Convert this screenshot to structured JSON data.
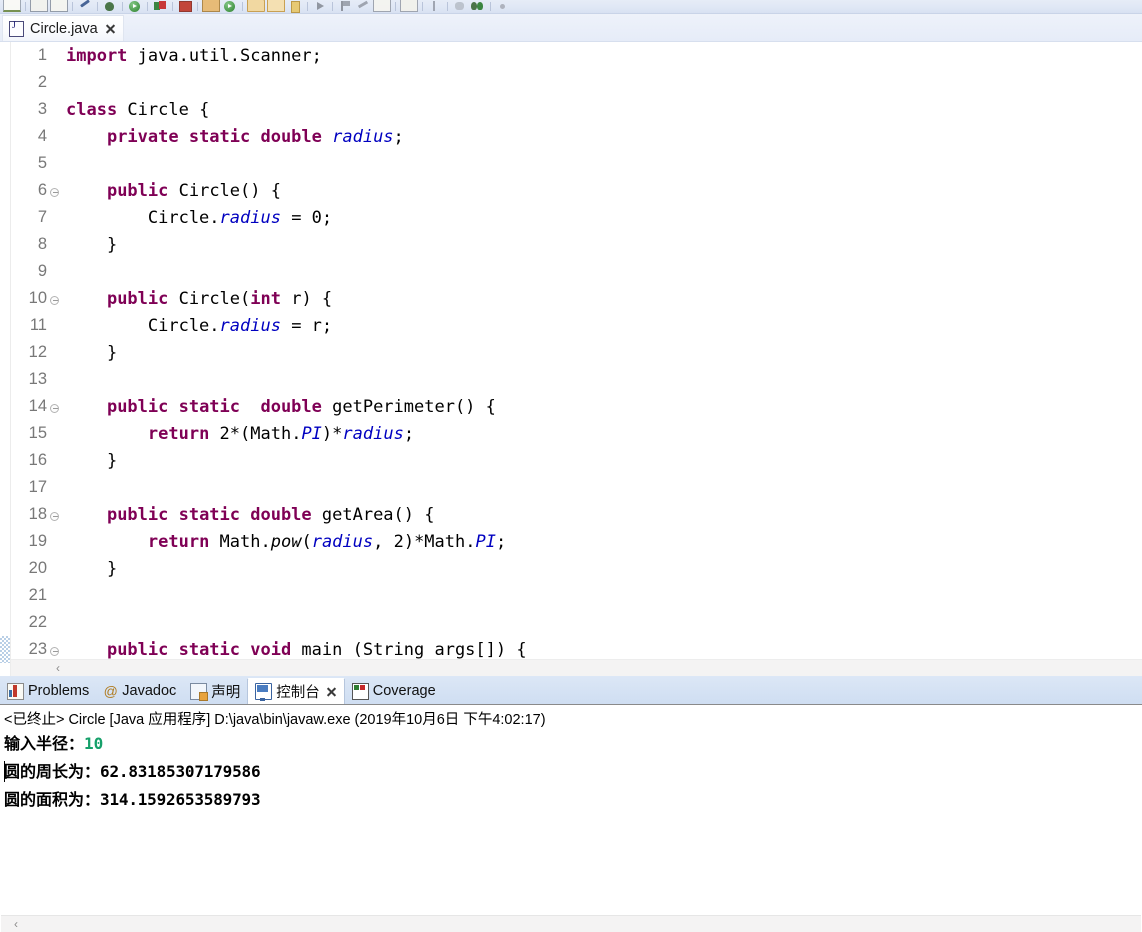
{
  "toolbar": {
    "icons": [
      "new-document-icon",
      "sep",
      "table-icon",
      "table-outline-icon",
      "sep",
      "search-icon",
      "sep",
      "debug-bug-icon",
      "sep",
      "run-icon",
      "sep",
      "green-red-squares-icon",
      "sep",
      "red-box-icon",
      "sep",
      "book-icon",
      "run-circle-icon",
      "sep",
      "folder-icon",
      "folder-open-icon",
      "yellow-tag-icon",
      "sep",
      "play-small-icon",
      "sep",
      "flag-icon",
      "pen-icon",
      "list-icon",
      "sep",
      "window-icon",
      "sep",
      "bar-icon",
      "sep",
      "palette-icon",
      "double-arrow-icon",
      "sep",
      "dot-icon"
    ]
  },
  "editor": {
    "tab": {
      "icon": "java-file-icon",
      "title": "Circle.java",
      "close_label": "close-tab"
    },
    "breakpoint_line": 23,
    "lines": [
      {
        "n": "1",
        "fold": false,
        "segments": [
          {
            "t": "import ",
            "c": "kw"
          },
          {
            "t": "java.util.Scanner;",
            "c": "plain"
          }
        ]
      },
      {
        "n": "2",
        "fold": false,
        "segments": [
          {
            "t": "",
            "c": "plain"
          }
        ]
      },
      {
        "n": "3",
        "fold": false,
        "segments": [
          {
            "t": "class ",
            "c": "kw"
          },
          {
            "t": "Circle {",
            "c": "plain"
          }
        ]
      },
      {
        "n": "4",
        "fold": false,
        "segments": [
          {
            "t": "    ",
            "c": "plain"
          },
          {
            "t": "private static double ",
            "c": "kw"
          },
          {
            "t": "radius",
            "c": "fld"
          },
          {
            "t": ";",
            "c": "plain"
          }
        ]
      },
      {
        "n": "5",
        "fold": false,
        "segments": [
          {
            "t": "",
            "c": "plain"
          }
        ]
      },
      {
        "n": "6",
        "fold": true,
        "segments": [
          {
            "t": "    ",
            "c": "plain"
          },
          {
            "t": "public ",
            "c": "kw"
          },
          {
            "t": "Circle() {",
            "c": "plain"
          }
        ]
      },
      {
        "n": "7",
        "fold": false,
        "segments": [
          {
            "t": "        Circle.",
            "c": "plain"
          },
          {
            "t": "radius",
            "c": "fld"
          },
          {
            "t": " = 0;",
            "c": "plain"
          }
        ]
      },
      {
        "n": "8",
        "fold": false,
        "segments": [
          {
            "t": "    }",
            "c": "plain"
          }
        ]
      },
      {
        "n": "9",
        "fold": false,
        "segments": [
          {
            "t": "",
            "c": "plain"
          }
        ]
      },
      {
        "n": "10",
        "fold": true,
        "segments": [
          {
            "t": "    ",
            "c": "plain"
          },
          {
            "t": "public ",
            "c": "kw"
          },
          {
            "t": "Circle(",
            "c": "plain"
          },
          {
            "t": "int",
            "c": "kw"
          },
          {
            "t": " r) {",
            "c": "plain"
          }
        ]
      },
      {
        "n": "11",
        "fold": false,
        "segments": [
          {
            "t": "        Circle.",
            "c": "plain"
          },
          {
            "t": "radius",
            "c": "fld"
          },
          {
            "t": " = r;",
            "c": "plain"
          }
        ]
      },
      {
        "n": "12",
        "fold": false,
        "segments": [
          {
            "t": "    }",
            "c": "plain"
          }
        ]
      },
      {
        "n": "13",
        "fold": false,
        "segments": [
          {
            "t": "",
            "c": "plain"
          }
        ]
      },
      {
        "n": "14",
        "fold": true,
        "segments": [
          {
            "t": "    ",
            "c": "plain"
          },
          {
            "t": "public static  double ",
            "c": "kw"
          },
          {
            "t": "getPerimeter() {",
            "c": "plain"
          }
        ]
      },
      {
        "n": "15",
        "fold": false,
        "segments": [
          {
            "t": "        ",
            "c": "plain"
          },
          {
            "t": "return",
            "c": "kw"
          },
          {
            "t": " 2*(Math.",
            "c": "plain"
          },
          {
            "t": "PI",
            "c": "fld"
          },
          {
            "t": ")*",
            "c": "plain"
          },
          {
            "t": "radius",
            "c": "fld"
          },
          {
            "t": ";",
            "c": "plain"
          }
        ]
      },
      {
        "n": "16",
        "fold": false,
        "segments": [
          {
            "t": "    }",
            "c": "plain"
          }
        ]
      },
      {
        "n": "17",
        "fold": false,
        "segments": [
          {
            "t": "",
            "c": "plain"
          }
        ]
      },
      {
        "n": "18",
        "fold": true,
        "segments": [
          {
            "t": "    ",
            "c": "plain"
          },
          {
            "t": "public static double ",
            "c": "kw"
          },
          {
            "t": "getArea() {",
            "c": "plain"
          }
        ]
      },
      {
        "n": "19",
        "fold": false,
        "segments": [
          {
            "t": "        ",
            "c": "plain"
          },
          {
            "t": "return",
            "c": "kw"
          },
          {
            "t": " Math.",
            "c": "plain"
          },
          {
            "t": "pow",
            "c": "mth"
          },
          {
            "t": "(",
            "c": "plain"
          },
          {
            "t": "radius",
            "c": "fld"
          },
          {
            "t": ", 2)*Math.",
            "c": "plain"
          },
          {
            "t": "PI",
            "c": "fld"
          },
          {
            "t": ";",
            "c": "plain"
          }
        ]
      },
      {
        "n": "20",
        "fold": false,
        "segments": [
          {
            "t": "    }",
            "c": "plain"
          }
        ]
      },
      {
        "n": "21",
        "fold": false,
        "segments": [
          {
            "t": "",
            "c": "plain"
          }
        ]
      },
      {
        "n": "22",
        "fold": false,
        "segments": [
          {
            "t": "",
            "c": "plain"
          }
        ]
      },
      {
        "n": "23",
        "fold": true,
        "segments": [
          {
            "t": "    ",
            "c": "plain"
          },
          {
            "t": "public static void ",
            "c": "kw"
          },
          {
            "t": "main (String args[]) {",
            "c": "plain"
          }
        ]
      }
    ],
    "scroll_left_arrow": "‹"
  },
  "bottom_view": {
    "tabs": [
      {
        "label": "Problems",
        "icon": "problems-icon",
        "active": false,
        "closable": false
      },
      {
        "label": "Javadoc",
        "icon": "javadoc-icon",
        "active": false,
        "closable": false
      },
      {
        "label": "声明",
        "icon": "declaration-icon",
        "active": false,
        "closable": false
      },
      {
        "label": "控制台",
        "icon": "console-icon",
        "active": true,
        "closable": true
      },
      {
        "label": "Coverage",
        "icon": "coverage-icon",
        "active": false,
        "closable": false
      }
    ],
    "console": {
      "status": "<已终止> Circle [Java 应用程序] D:\\java\\bin\\javaw.exe  (2019年10月6日 下午4:02:17)",
      "output": [
        {
          "label": "输入半径：",
          "value": "10",
          "kind": "input"
        },
        {
          "label": "圆的周长为：",
          "value": "62.83185307179586",
          "kind": "output"
        },
        {
          "label": "圆的面积为：",
          "value": "314.1592653589793",
          "kind": "output"
        }
      ],
      "scroll_left_arrow": "‹"
    }
  },
  "colors": {
    "keyword": "#7f0055",
    "field": "#0000c0",
    "console_input": "#16a06a",
    "tab_active_bg": "#ffffff",
    "view_tabbar_bg": "#cfdef2"
  }
}
